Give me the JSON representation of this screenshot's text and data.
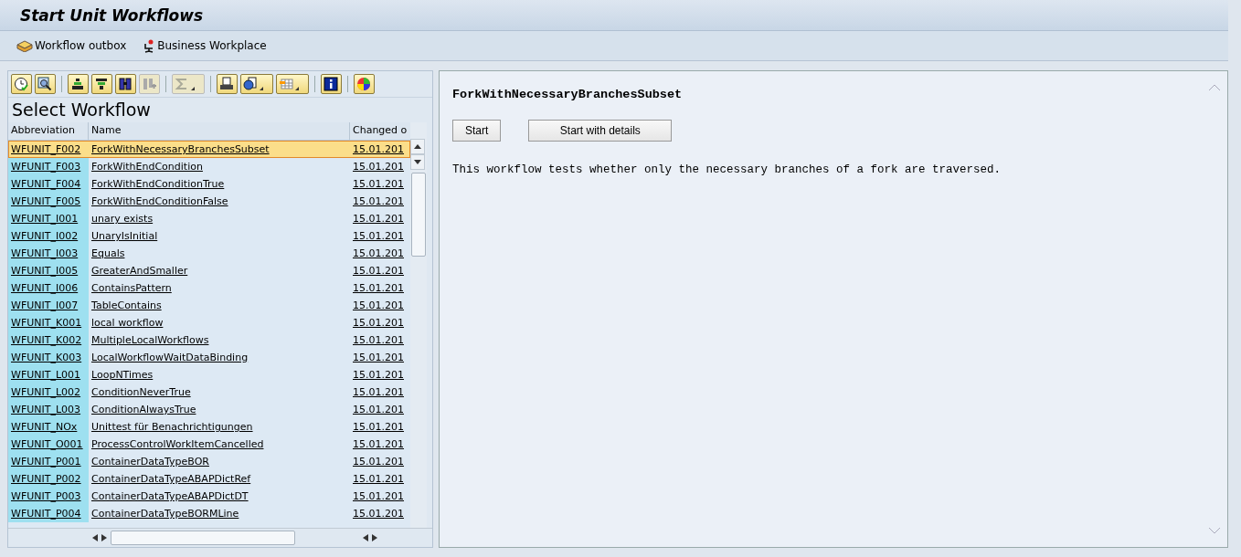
{
  "window": {
    "title": "Start Unit Workflows"
  },
  "app_toolbar": [
    {
      "label": "Workflow outbox"
    },
    {
      "label": "Business Workplace"
    }
  ],
  "list": {
    "title": "Select Workflow",
    "columns": [
      "Abbreviation",
      "Name",
      "Changed o"
    ],
    "rows": [
      {
        "abbreviation": "WFUNIT_F002",
        "name": "ForkWithNecessaryBranchesSubset",
        "changed": "15.01.201",
        "selected": true
      },
      {
        "abbreviation": "WFUNIT_F003",
        "name": "ForkWithEndCondition",
        "changed": "15.01.201",
        "selected": false
      },
      {
        "abbreviation": "WFUNIT_F004",
        "name": "ForkWithEndConditionTrue",
        "changed": "15.01.201",
        "selected": false
      },
      {
        "abbreviation": "WFUNIT_F005",
        "name": "ForkWithEndConditionFalse",
        "changed": "15.01.201",
        "selected": false
      },
      {
        "abbreviation": "WFUNIT_I001",
        "name": "unary exists",
        "changed": "15.01.201",
        "selected": false
      },
      {
        "abbreviation": "WFUNIT_I002",
        "name": "UnaryIsInitial",
        "changed": "15.01.201",
        "selected": false
      },
      {
        "abbreviation": "WFUNIT_I003",
        "name": "Equals",
        "changed": "15.01.201",
        "selected": false
      },
      {
        "abbreviation": "WFUNIT_I005",
        "name": "GreaterAndSmaller",
        "changed": "15.01.201",
        "selected": false
      },
      {
        "abbreviation": "WFUNIT_I006",
        "name": "ContainsPattern",
        "changed": "15.01.201",
        "selected": false
      },
      {
        "abbreviation": "WFUNIT_I007",
        "name": "TableContains",
        "changed": "15.01.201",
        "selected": false
      },
      {
        "abbreviation": "WFUNIT_K001",
        "name": "local workflow",
        "changed": "15.01.201",
        "selected": false
      },
      {
        "abbreviation": "WFUNIT_K002",
        "name": "MultipleLocalWorkflows",
        "changed": "15.01.201",
        "selected": false
      },
      {
        "abbreviation": "WFUNIT_K003",
        "name": "LocalWorkflowWaitDataBinding",
        "changed": "15.01.201",
        "selected": false
      },
      {
        "abbreviation": "WFUNIT_L001",
        "name": "LoopNTimes",
        "changed": "15.01.201",
        "selected": false
      },
      {
        "abbreviation": "WFUNIT_L002",
        "name": "ConditionNeverTrue",
        "changed": "15.01.201",
        "selected": false
      },
      {
        "abbreviation": "WFUNIT_L003",
        "name": "ConditionAlwaysTrue",
        "changed": "15.01.201",
        "selected": false
      },
      {
        "abbreviation": "WFUNIT_NOx",
        "name": "Unittest für Benachrichtigungen",
        "changed": "15.01.201",
        "selected": false
      },
      {
        "abbreviation": "WFUNIT_O001",
        "name": "ProcessControlWorkItemCancelled",
        "changed": "15.01.201",
        "selected": false
      },
      {
        "abbreviation": "WFUNIT_P001",
        "name": "ContainerDataTypeBOR",
        "changed": "15.01.201",
        "selected": false
      },
      {
        "abbreviation": "WFUNIT_P002",
        "name": "ContainerDataTypeABAPDictRef",
        "changed": "15.01.201",
        "selected": false
      },
      {
        "abbreviation": "WFUNIT_P003",
        "name": "ContainerDataTypeABAPDictDT",
        "changed": "15.01.201",
        "selected": false
      },
      {
        "abbreviation": "WFUNIT_P004",
        "name": "ContainerDataTypeBORMLine",
        "changed": "15.01.201",
        "selected": false
      }
    ]
  },
  "detail": {
    "heading": "ForkWithNecessaryBranchesSubset",
    "buttons": [
      "Start",
      "Start with details"
    ],
    "description": "This workflow tests whether only the necessary branches of a fork are traversed."
  }
}
